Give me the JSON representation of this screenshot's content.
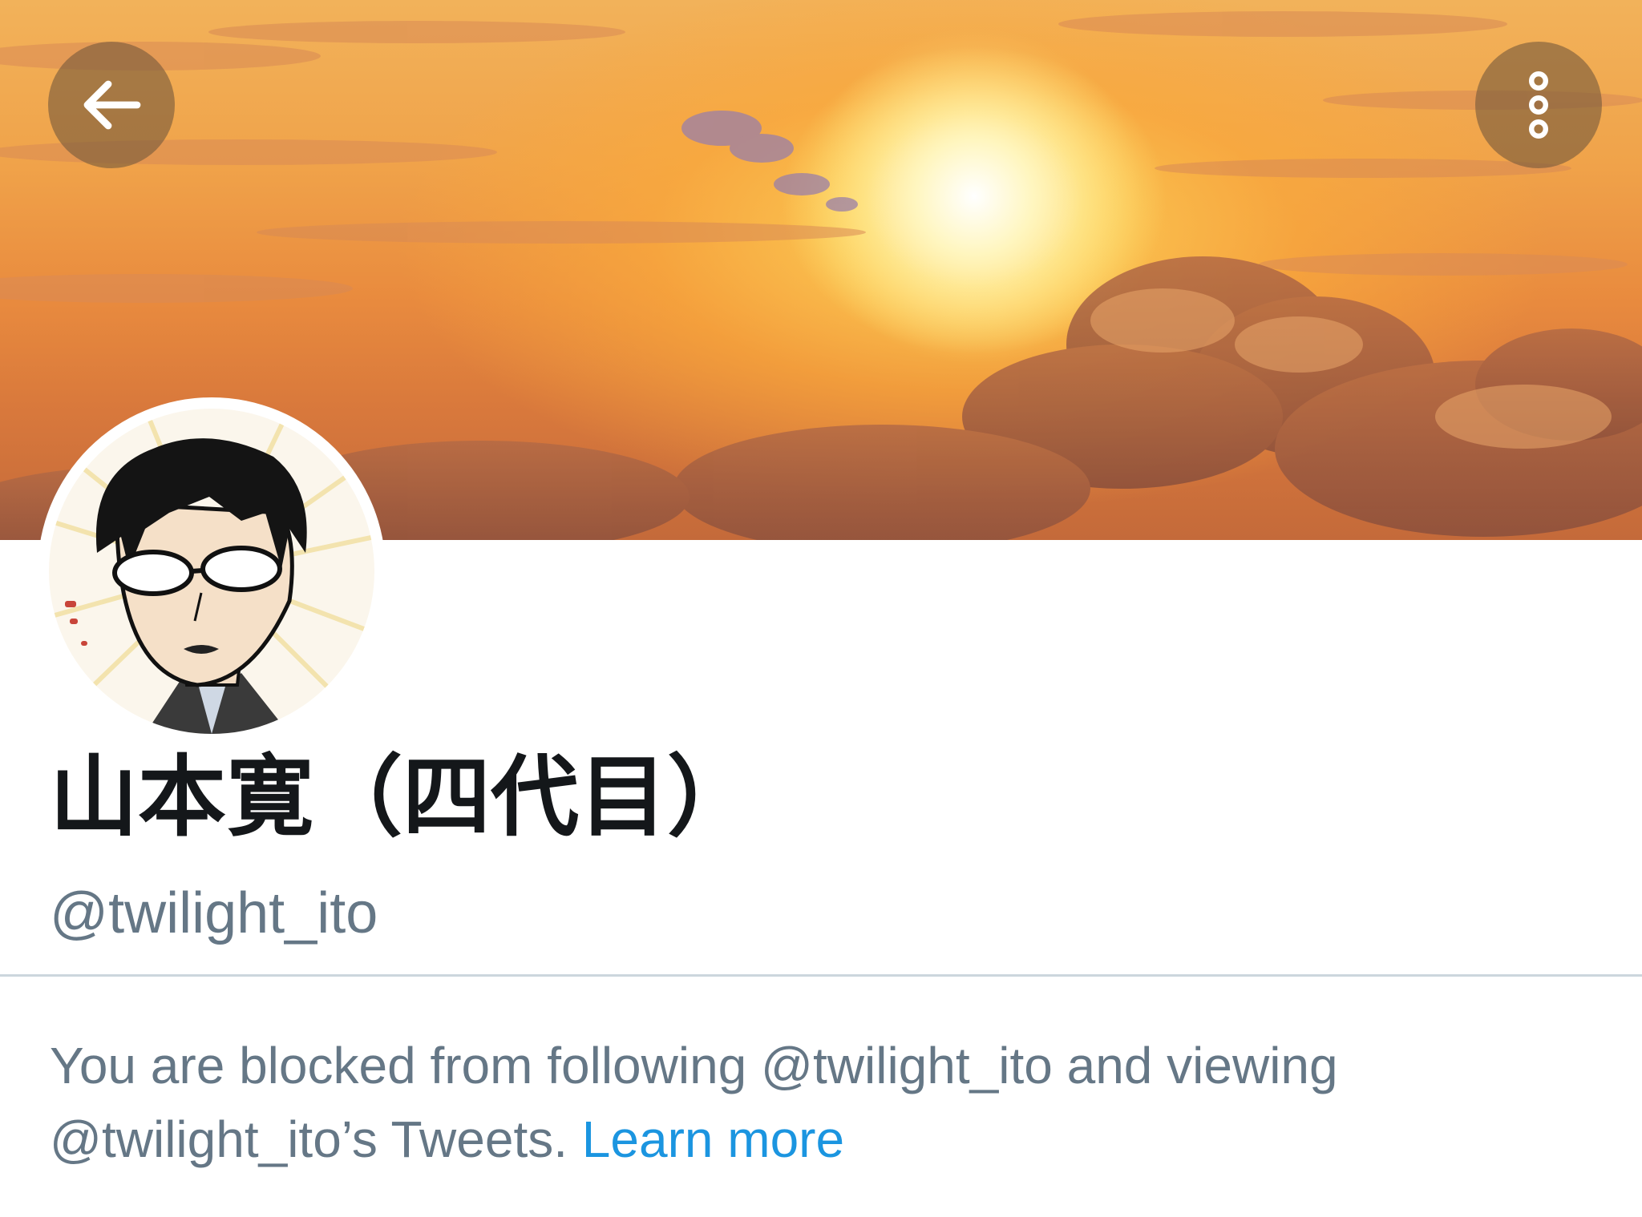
{
  "header": {
    "back_icon": "arrow-left-icon",
    "more_icon": "more-vertical-icon"
  },
  "profile": {
    "display_name": "山本寛（四代目）",
    "handle": "@twilight_ito"
  },
  "notice": {
    "line1": "You are blocked from following @twilight_ito and viewing",
    "line2": "@twilight_ito’s Tweets.",
    "learn_more": "Learn more"
  },
  "colors": {
    "text_primary": "#14171a",
    "text_secondary": "#657786",
    "link": "#1b95e0",
    "divider": "#ccd6dd"
  }
}
